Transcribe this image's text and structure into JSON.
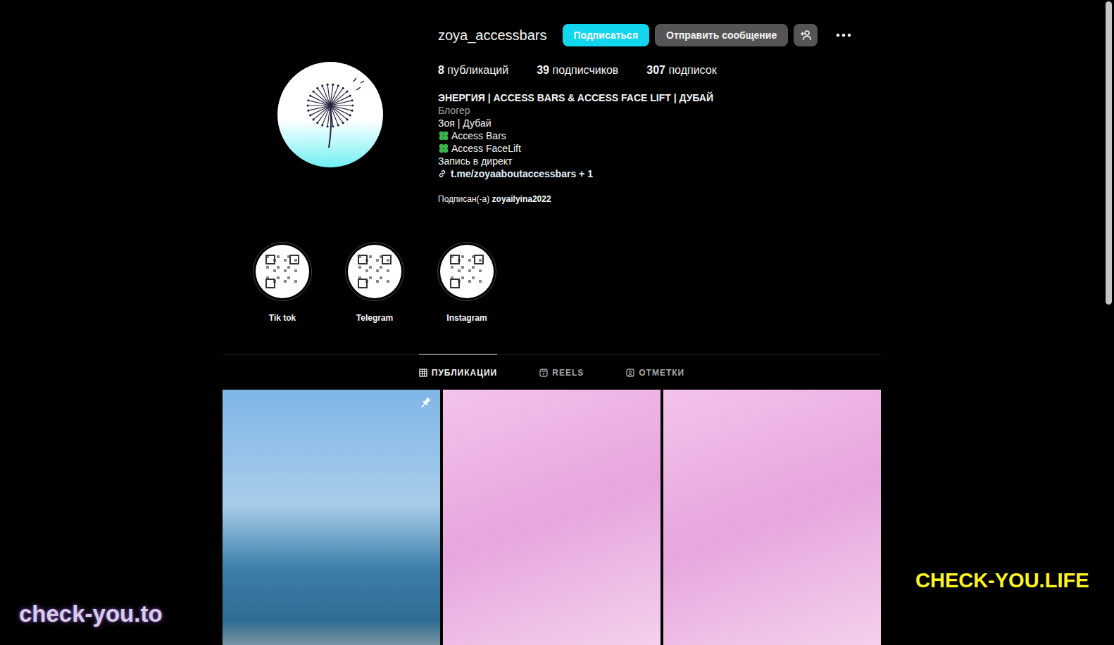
{
  "profile": {
    "username": "zoya_accessbars",
    "follow_button": "Подписаться",
    "message_button": "Отправить сообщение"
  },
  "stats": [
    {
      "count": "8",
      "label": "публикаций"
    },
    {
      "count": "39",
      "label": "подписчиков"
    },
    {
      "count": "307",
      "label": "подписок"
    }
  ],
  "bio": {
    "title": "ЭНЕРГИЯ | ACCESS BARS & ACCESS FACE LIFT | ДУБАЙ",
    "category": "Блогер",
    "lines": [
      {
        "text": "Зоя | Дубай",
        "kind": "text"
      },
      {
        "text": "Access Bars",
        "kind": "clover"
      },
      {
        "text": "Access FaceLift",
        "kind": "clover"
      },
      {
        "text": "Запись в директ",
        "kind": "text"
      }
    ],
    "link": "t.me/zoyaaboutaccessbars + 1"
  },
  "followed_by": {
    "prefix": "Подписан(-а)",
    "user": "zoyailyina2022"
  },
  "highlights": [
    {
      "label": "Tik tok"
    },
    {
      "label": "Telegram"
    },
    {
      "label": "Instagram"
    }
  ],
  "tabs": [
    {
      "label": "ПУБЛИКАЦИИ",
      "selected": true
    },
    {
      "label": "REELS",
      "selected": false
    },
    {
      "label": "ОТМЕТКИ",
      "selected": false
    }
  ],
  "posts": [
    {
      "pinned": true
    },
    {
      "pinned": false
    },
    {
      "pinned": false
    }
  ],
  "watermarks": [
    "check-you.to",
    "CHECK-YOU.LIFE"
  ],
  "scrollbar": {
    "level": 0.47
  }
}
